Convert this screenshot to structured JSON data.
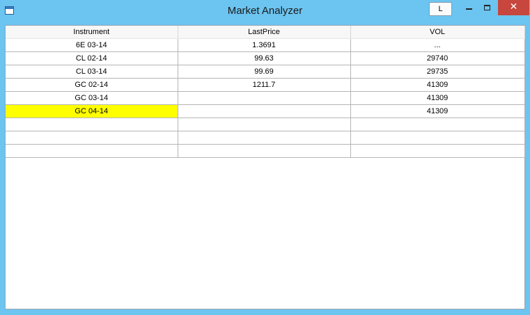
{
  "window": {
    "title": "Market Analyzer",
    "l_button_label": "L"
  },
  "grid": {
    "columns": [
      "Instrument",
      "LastPrice",
      "VOL"
    ],
    "rows": [
      {
        "instrument": "6E 03-14",
        "last_price": "1.3691",
        "vol": "..."
      },
      {
        "instrument": "CL 02-14",
        "last_price": "99.63",
        "vol": "29740"
      },
      {
        "instrument": "CL 03-14",
        "last_price": "99.69",
        "vol": "29735"
      },
      {
        "instrument": "GC 02-14",
        "last_price": "1211.7",
        "vol": "41309"
      },
      {
        "instrument": "GC 03-14",
        "last_price": "",
        "vol": "41309"
      },
      {
        "instrument": "GC 04-14",
        "last_price": "",
        "vol": "41309",
        "selected": true
      },
      {
        "instrument": "",
        "last_price": "",
        "vol": ""
      },
      {
        "instrument": "",
        "last_price": "",
        "vol": ""
      },
      {
        "instrument": "",
        "last_price": "",
        "vol": ""
      }
    ],
    "selected_color": "#ffff00"
  },
  "colors": {
    "titlebar": "#6cc4f0",
    "close_button": "#c7463d"
  },
  "icons": {
    "app": "window-app-icon",
    "minimize": "minimize-icon",
    "maximize": "maximize-icon",
    "close": "close-icon"
  }
}
